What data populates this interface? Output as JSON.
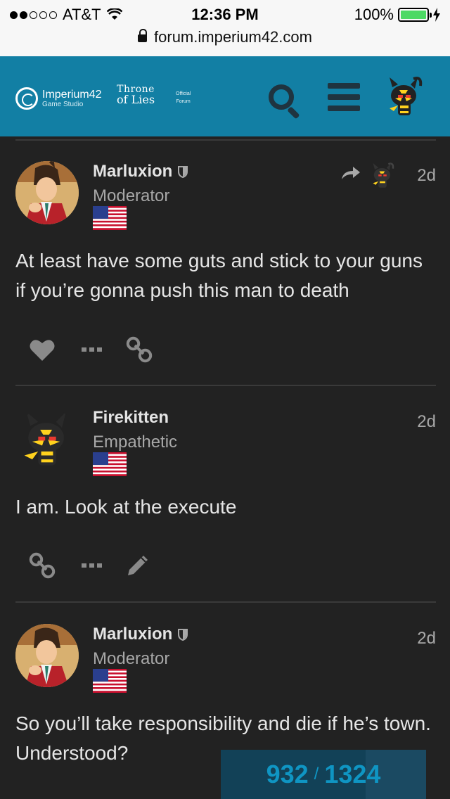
{
  "status_bar": {
    "carrier": "AT&T",
    "time": "12:36 PM",
    "battery": "100%",
    "url": "forum.imperium42.com"
  },
  "header": {
    "brand_name": "Imperium42",
    "brand_sub": "Game Studio",
    "game_logo_line1": "Throne",
    "game_logo_line2": "of Lies",
    "official_line1": "Official",
    "official_line2": "Forum",
    "icons": [
      "search-icon",
      "hamburger-menu-icon",
      "user-avatar"
    ]
  },
  "posts": [
    {
      "username": "Marluxion",
      "user_title": "Moderator",
      "date": "2d",
      "body": "At least have some guts and stick to your guns if you’re gonna push this man to death",
      "reply_to": true,
      "actions": [
        "like-icon",
        "more-icon",
        "link-icon"
      ]
    },
    {
      "username": "Firekitten",
      "user_title": "Empathetic",
      "date": "2d",
      "body": "I am. Look at the execute",
      "reply_to": false,
      "actions": [
        "link-icon",
        "more-icon",
        "edit-icon"
      ]
    },
    {
      "username": "Marluxion",
      "user_title": "Moderator",
      "date": "2d",
      "body": "So you’ll take responsibility and die if he’s town. Understood?",
      "reply_to": false,
      "actions": []
    }
  ],
  "progress": {
    "current": "932",
    "total": "1324",
    "fraction": 0.704
  },
  "colors": {
    "header_bg": "#127fa4",
    "page_bg": "#222222",
    "progress_text": "#0f95c3"
  }
}
